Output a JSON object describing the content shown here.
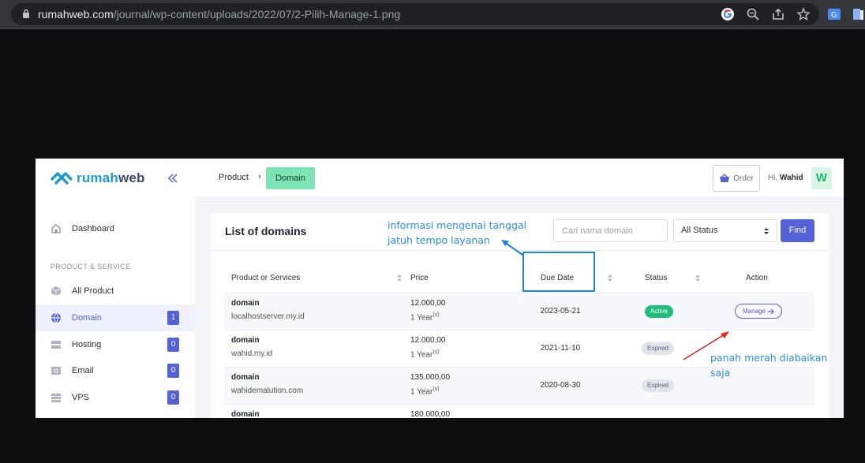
{
  "browser": {
    "url_host": "rumahweb.com",
    "url_path": "/journal/wp-content/uploads/2022/07/2-Pilih-Manage-1.png",
    "icons": [
      "lock-icon",
      "google-icon",
      "zoom-icon",
      "share-icon",
      "star-icon",
      "translate-icon",
      "extension-icon"
    ]
  },
  "sidebar": {
    "logo_rumah": "rumah",
    "logo_web": "web",
    "section_label": "PRODUCT & SERVICE",
    "items": [
      {
        "label": "Dashboard",
        "icon": "home-icon"
      },
      {
        "label": "All Product",
        "icon": "box-icon"
      },
      {
        "label": "Domain",
        "icon": "globe-icon",
        "badge": "1",
        "active": true
      },
      {
        "label": "Hosting",
        "icon": "server-icon",
        "badge": "0"
      },
      {
        "label": "Email",
        "icon": "email-icon",
        "badge": "0"
      },
      {
        "label": "VPS",
        "icon": "vps-icon",
        "badge": "0"
      }
    ]
  },
  "header": {
    "breadcrumb_product": "Product",
    "breadcrumb_sep": "›",
    "breadcrumb_domain": "Domain",
    "order_label": "Order",
    "greeting_prefix": "Hi,",
    "user_name": "Wahid",
    "avatar_letter": "W"
  },
  "card": {
    "title": "List of domains",
    "search_placeholder": "Cari nama domain",
    "status_value": "All Status",
    "find_label": "Find",
    "columns": {
      "product": "Product or Services",
      "price": "Price",
      "due_date": "Due Date",
      "status": "Status",
      "action": "Action"
    },
    "rows": [
      {
        "service": "domain",
        "host": "localhostserver.my.id",
        "price": "12.000,00",
        "cycle": "1 Year",
        "cycle_sup": "(s)",
        "due": "2023-05-21",
        "status": "Active",
        "action": "Manage"
      },
      {
        "service": "domain",
        "host": "wahid.my.id",
        "price": "12.000,00",
        "cycle": "1 Year",
        "cycle_sup": "(s)",
        "due": "2021-11-10",
        "status": "Expired"
      },
      {
        "service": "domain",
        "host": "wahidemalution.com",
        "price": "135.000,00",
        "cycle": "1 Year",
        "cycle_sup": "(s)",
        "due": "2020-08-30",
        "status": "Expired"
      },
      {
        "service": "domain",
        "price": "180.000,00"
      }
    ]
  },
  "annotations": {
    "blue_line1": "informasi mengenai tanggal",
    "blue_line2": "jatuh tempo layanan",
    "red_line1": "panah merah diabaikan",
    "red_line2": "saja",
    "blue_color": "#1f83e0",
    "red_color": "#e3221e"
  },
  "colors": {
    "accent": "#5561d6",
    "active_green": "#1fbf7a",
    "breadcrumb_green": "#7de4b4"
  }
}
